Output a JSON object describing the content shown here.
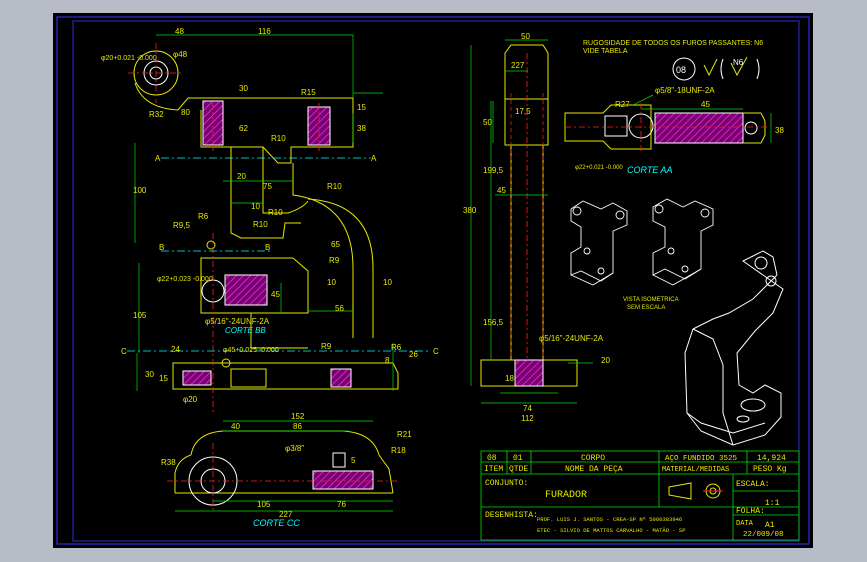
{
  "colors": {
    "background": "#000000",
    "frame": "#2e2ed6",
    "part": "#ffffff",
    "yellow": "#e8e800",
    "cyan": "#00ffff",
    "green": "#00e000",
    "red": "#ff2020",
    "magenta": "#c000c0"
  },
  "note": {
    "line1": "RUGOSIDADE DE TODOS OS FUROS PASSANTES: N6",
    "line2": "VIDE TABELA",
    "symbol_circle": "08",
    "symbol_roughness": "N6"
  },
  "front_view": {
    "dims": {
      "top_48": "48",
      "top_116": "116",
      "diameter": "φ20+0.021 -0.000",
      "dia_48": "φ48",
      "r32": "R32",
      "a80": "80",
      "r15": "R15",
      "d15": "15",
      "d38": "38",
      "d30": "30",
      "d62": "62",
      "r10a": "R10",
      "d20": "20",
      "d75": "75",
      "r10b": "R10",
      "d100": "100",
      "d10a": "10",
      "r6": "R6",
      "r95": "R9,5",
      "r10c": "R10",
      "r10d": "R10",
      "a65": "65",
      "r9a": "R9",
      "phi22": "φ22+0.023 -0.000",
      "d45": "45",
      "d10b": "10",
      "d10c": "10",
      "d56": "56",
      "d105": "105",
      "thread": "φ5/16\"-24UNF-2A",
      "r9b": "R9",
      "phi45": "φ45+0.025 -0.000",
      "d24": "24",
      "r6b": "R6",
      "d26": "26",
      "d8": "8",
      "d30b": "30",
      "d15b": "15",
      "phi20": "φ20",
      "sec_a": "A",
      "sec_b": "B",
      "sec_c": "C"
    },
    "label_corte_bb": "CORTE BB"
  },
  "side_view": {
    "dims": {
      "d50": "50",
      "d227": "227",
      "d17_5": "17,5",
      "d50b": "50",
      "d199_5": "199,5",
      "d380": "380",
      "d45": "45",
      "d156_5": "156,5",
      "thread": "φ5/16\"-24UNF-2A",
      "d18": "18",
      "d20": "20",
      "d74": "74",
      "d112": "112"
    }
  },
  "section_aa": {
    "label": "CORTE AA",
    "dims": {
      "thread": "φ5/8\"-18UNF-2A",
      "r27": "R27",
      "d45": "45",
      "d38": "38",
      "phi22": "φ22+0.021 -0.000"
    }
  },
  "section_cc": {
    "label": "CORTE CC",
    "dims": {
      "d152": "152",
      "d40": "40",
      "d86": "86",
      "r21": "R21",
      "phi38": "φ3/8\"",
      "r18": "R18",
      "r38": "R38",
      "d5": "5",
      "d105": "105",
      "d76": "76",
      "d227": "227"
    }
  },
  "iso_caption": {
    "line1": "VISTA ISOMETRICA",
    "line2": "SEM ESCALA"
  },
  "title_block": {
    "row1": {
      "item": "08",
      "qty": "01",
      "name": "CORPO",
      "material": "AÇO FUNDIDO 3525",
      "weight": "14,924"
    },
    "row2": {
      "item": "ITEM",
      "qty": "QTDE",
      "name": "NOME DA PEÇA",
      "material": "MATERIAL/MEDIDAS",
      "weight": "PESO Kg"
    },
    "conjunto_label": "CONJUNTO:",
    "conjunto_value": "FURADOR",
    "escala_label": "ESCALA:",
    "escala_value": "1:1",
    "folha_label": "FOLHA:",
    "folha_value": "A1",
    "desenhista_label": "DESENHISTA:",
    "desenhista_line1": "PROF. LUIS J. SANTOS - CREA-SP Nº 5060383946",
    "desenhista_line2": "ETEC - SILVIO DE MATTOS CARVALHO - MATÃO - SP",
    "data_label": "DATA",
    "data_value": "22/009/08"
  }
}
